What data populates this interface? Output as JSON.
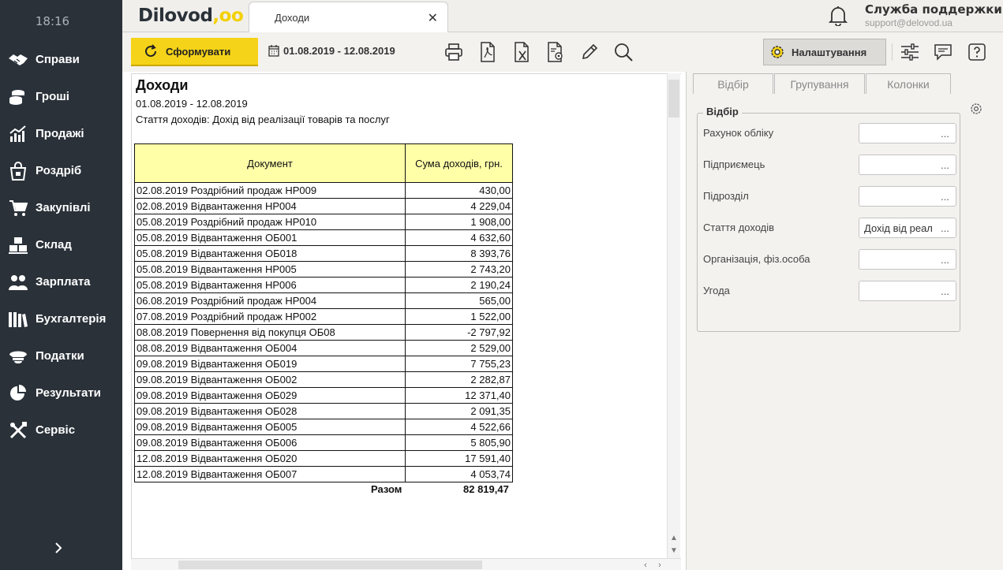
{
  "sidebar": {
    "time": "18:16",
    "items": [
      {
        "label": "Справи",
        "icon": "handshake-icon"
      },
      {
        "label": "Гроші",
        "icon": "coins-icon"
      },
      {
        "label": "Продажі",
        "icon": "chart-icon"
      },
      {
        "label": "Роздріб",
        "icon": "shopping-bag-icon"
      },
      {
        "label": "Закупівлі",
        "icon": "cart-icon"
      },
      {
        "label": "Склад",
        "icon": "boxes-icon"
      },
      {
        "label": "Зарплата",
        "icon": "people-icon"
      },
      {
        "label": "Бухгалтерія",
        "icon": "books-icon"
      },
      {
        "label": "Податки",
        "icon": "officer-cap-icon"
      },
      {
        "label": "Результати",
        "icon": "pie-chart-icon"
      },
      {
        "label": "Сервіс",
        "icon": "tools-icon"
      }
    ]
  },
  "header": {
    "logo": "Dilovod",
    "logo_dots": ",oo",
    "tab_title": "Доходи",
    "support_name": "Служба поддержки",
    "support_email": "support@delovod.ua"
  },
  "toolbar": {
    "form_button": "Сформувати",
    "period": "01.08.2019 - 12.08.2019",
    "settings_button": "Налаштування"
  },
  "report": {
    "title": "Доходи",
    "period": "01.08.2019 - 12.08.2019",
    "filter": "Стаття доходів:  Дохід від реалізації товарів та послуг",
    "columns": [
      "Документ",
      "Сума доходів, грн."
    ],
    "rows": [
      {
        "doc": "02.08.2019 Роздрібний продаж НР009",
        "sum": "430,00"
      },
      {
        "doc": "02.08.2019 Відвантаження НР004",
        "sum": "4 229,04"
      },
      {
        "doc": "05.08.2019 Роздрібний продаж НР010",
        "sum": "1 908,00"
      },
      {
        "doc": "05.08.2019 Відвантаження ОБ001",
        "sum": "4 632,60"
      },
      {
        "doc": "05.08.2019 Відвантаження ОБ018",
        "sum": "8 393,76"
      },
      {
        "doc": "05.08.2019 Відвантаження НР005",
        "sum": "2 743,20"
      },
      {
        "doc": "05.08.2019 Відвантаження НР006",
        "sum": "2 190,24"
      },
      {
        "doc": "06.08.2019 Роздрібний продаж НР004",
        "sum": "565,00"
      },
      {
        "doc": "07.08.2019 Роздрібний продаж НР002",
        "sum": "1 522,00"
      },
      {
        "doc": "08.08.2019 Повернення від покупця ОБ08",
        "sum": "-2 797,92"
      },
      {
        "doc": "08.08.2019 Відвантаження ОБ004",
        "sum": "2 529,00"
      },
      {
        "doc": "09.08.2019 Відвантаження ОБ019",
        "sum": "7 755,23"
      },
      {
        "doc": "09.08.2019 Відвантаження ОБ002",
        "sum": "2 282,87"
      },
      {
        "doc": "09.08.2019 Відвантаження ОБ029",
        "sum": "12 371,40"
      },
      {
        "doc": "09.08.2019 Відвантаження ОБ028",
        "sum": "2 091,35"
      },
      {
        "doc": "09.08.2019 Відвантаження ОБ005",
        "sum": "4 522,66"
      },
      {
        "doc": "09.08.2019 Відвантаження ОБ006",
        "sum": "5 805,90"
      },
      {
        "doc": "12.08.2019 Відвантаження ОБ020",
        "sum": "17 591,40"
      },
      {
        "doc": "12.08.2019 Відвантаження ОБ007",
        "sum": "4 053,74"
      }
    ],
    "total_label": "Разом",
    "total_value": "82 819,47"
  },
  "panel": {
    "tabs": [
      "Відбір",
      "Групування",
      "Колонки"
    ],
    "group_title": "Відбір",
    "fields": [
      {
        "label": "Рахунок обліку",
        "value": ""
      },
      {
        "label": "Підприємець",
        "value": ""
      },
      {
        "label": "Підрозділ",
        "value": ""
      },
      {
        "label": "Стаття доходів",
        "value": "Дохід від реал"
      },
      {
        "label": "Організація, фіз.особа",
        "value": ""
      },
      {
        "label": "Угода",
        "value": ""
      }
    ],
    "dots": "..."
  }
}
